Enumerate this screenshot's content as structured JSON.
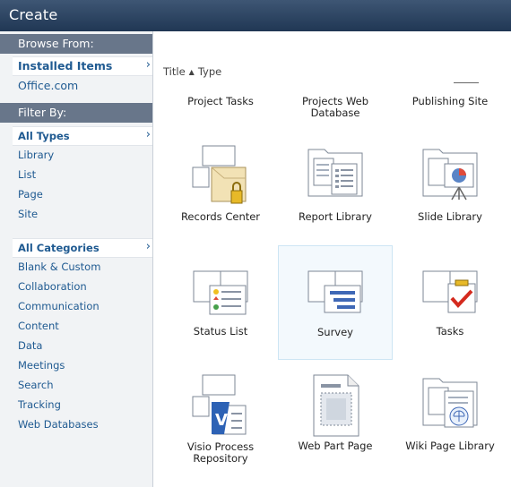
{
  "title": "Create",
  "browse": {
    "header": "Browse From:",
    "items": [
      "Installed Items",
      "Office.com"
    ]
  },
  "filter": {
    "header": "Filter By:",
    "types_selected": "All Types",
    "types": [
      "Library",
      "List",
      "Page",
      "Site"
    ],
    "categories_selected": "All Categories",
    "categories": [
      "Blank & Custom",
      "Collaboration",
      "Communication",
      "Content",
      "Data",
      "Meetings",
      "Search",
      "Tracking",
      "Web Databases"
    ]
  },
  "sort": {
    "col1": "Title",
    "col2": "Type"
  },
  "top_row": [
    "Project Tasks",
    "Projects Web\nDatabase",
    "Publishing Site"
  ],
  "tiles": [
    {
      "label": "Records Center",
      "icon": "records-center-icon"
    },
    {
      "label": "Report Library",
      "icon": "report-library-icon"
    },
    {
      "label": "Slide Library",
      "icon": "slide-library-icon"
    },
    {
      "label": "Status List",
      "icon": "status-list-icon"
    },
    {
      "label": "Survey",
      "icon": "survey-icon"
    },
    {
      "label": "Tasks",
      "icon": "tasks-icon"
    },
    {
      "label": "Visio Process\nRepository",
      "icon": "visio-repository-icon"
    },
    {
      "label": "Web Part Page",
      "icon": "web-part-page-icon"
    },
    {
      "label": "Wiki Page Library",
      "icon": "wiki-page-library-icon"
    }
  ],
  "colors": {
    "titlebar": "#2a4160",
    "link": "#1f5a91",
    "section_header": "#68768a",
    "selected_tile": "#f3f9fd"
  }
}
